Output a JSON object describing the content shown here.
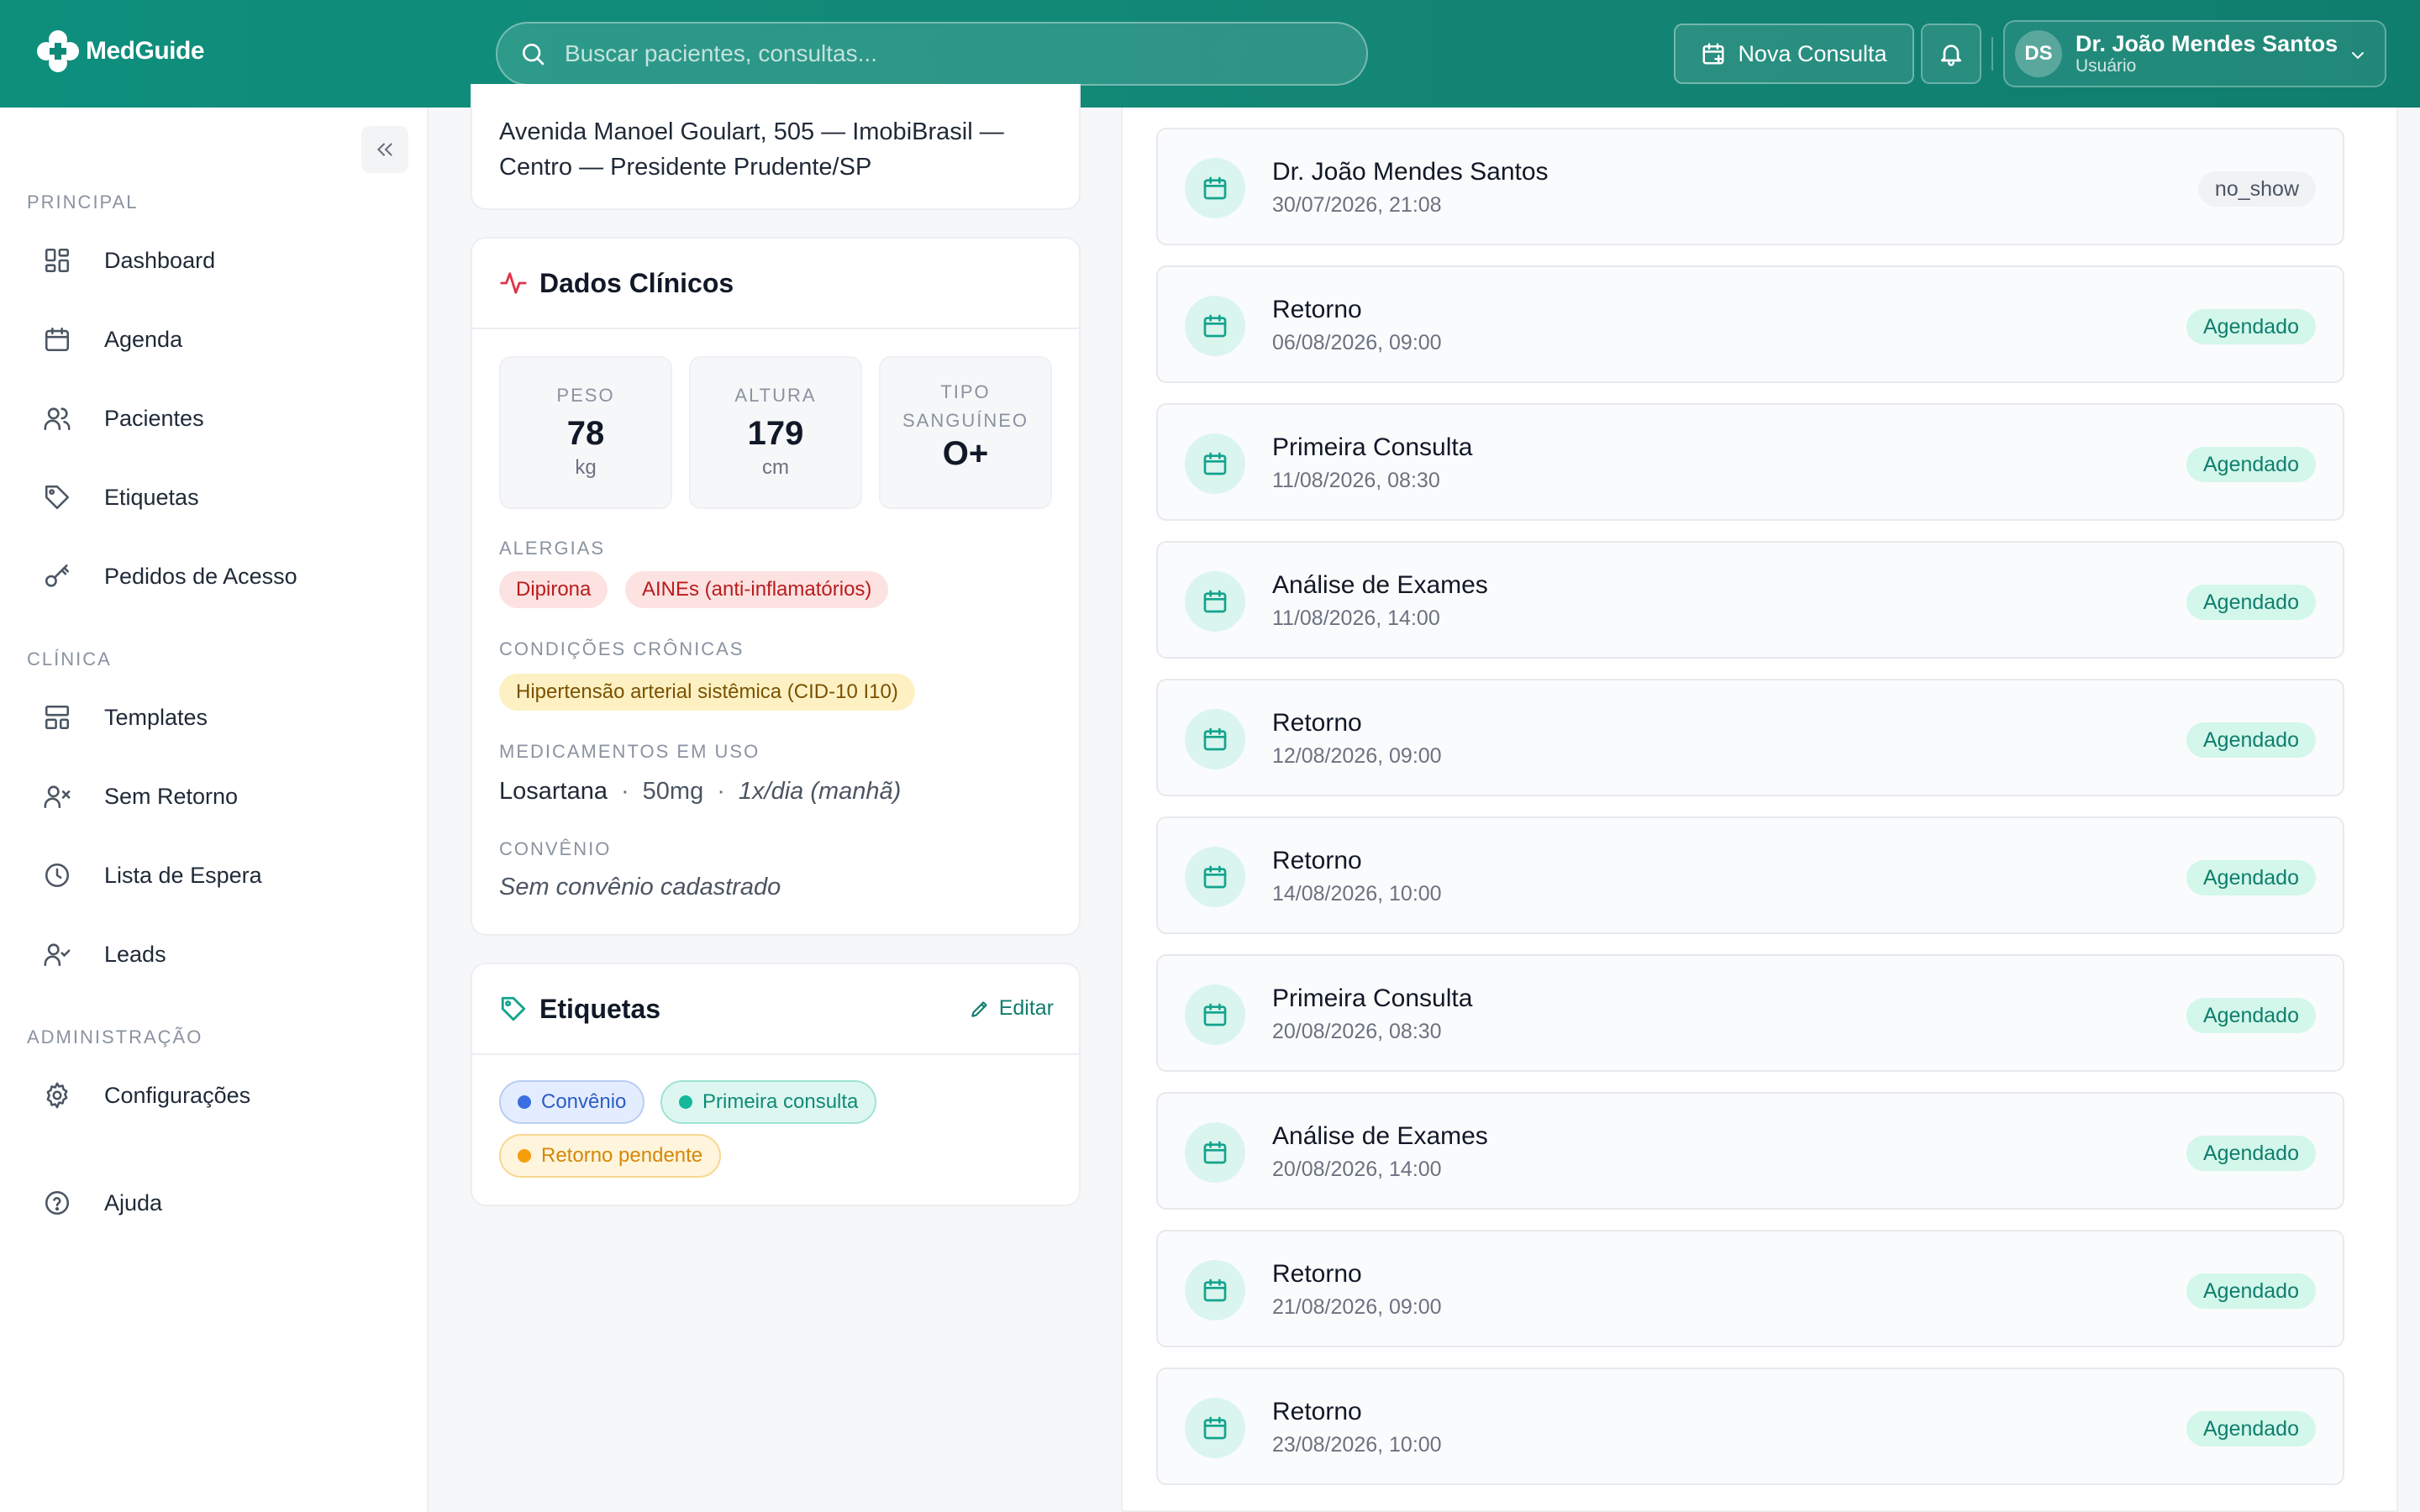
{
  "brand": {
    "name": "MedGuide",
    "colors": {
      "primary": "#0f7e6e",
      "accent": "#d3f7ea"
    }
  },
  "search": {
    "placeholder": "Buscar pacientes, consultas..."
  },
  "header": {
    "new_consult_label": "Nova Consulta",
    "user": {
      "initials": "DS",
      "name": "Dr. João Mendes Santos",
      "role": "Usuário"
    }
  },
  "sidebar": {
    "sections": [
      {
        "label": "PRINCIPAL",
        "items": [
          {
            "label": "Dashboard",
            "icon": "dashboard-icon"
          },
          {
            "label": "Agenda",
            "icon": "calendar-icon"
          },
          {
            "label": "Pacientes",
            "icon": "users-icon"
          },
          {
            "label": "Etiquetas",
            "icon": "tag-icon"
          },
          {
            "label": "Pedidos de Acesso",
            "icon": "key-icon"
          }
        ]
      },
      {
        "label": "CLÍNICA",
        "items": [
          {
            "label": "Templates",
            "icon": "layout-icon"
          },
          {
            "label": "Sem Retorno",
            "icon": "user-x-icon"
          },
          {
            "label": "Lista de Espera",
            "icon": "clock-icon"
          },
          {
            "label": "Leads",
            "icon": "user-check-icon"
          }
        ]
      },
      {
        "label": "ADMINISTRAÇÃO",
        "items": [
          {
            "label": "Configurações",
            "icon": "gear-icon"
          }
        ]
      }
    ],
    "help_label": "Ajuda"
  },
  "patient": {
    "address": "Avenida Manoel Goulart, 505 — ImobiBrasil — Centro — Presidente Prudente/SP"
  },
  "clinical": {
    "title": "Dados Clínicos",
    "metrics": [
      {
        "label": "PESO",
        "value": "78",
        "unit": "kg"
      },
      {
        "label": "ALTURA",
        "value": "179",
        "unit": "cm"
      },
      {
        "label": "TIPO SANGUÍNEO",
        "value": "O+",
        "unit": ""
      }
    ],
    "allergies_label": "ALERGIAS",
    "allergies": [
      "Dipirona",
      "AINEs (anti-inflamatórios)"
    ],
    "chronic_label": "CONDIÇÕES CRÔNICAS",
    "chronic": [
      "Hipertensão arterial sistêmica (CID-10 I10)"
    ],
    "medications_label": "MEDICAMENTOS EM USO",
    "medication": {
      "name": "Losartana",
      "dose": "50mg",
      "frequency": "1x/dia (manhã)",
      "separator": "·"
    },
    "insurance_label": "CONVÊNIO",
    "insurance_value": "Sem convênio cadastrado"
  },
  "tags": {
    "title": "Etiquetas",
    "edit_label": "Editar",
    "items": [
      {
        "label": "Convênio",
        "color": "#3b6fe0"
      },
      {
        "label": "Primeira consulta",
        "color": "#14b89a"
      },
      {
        "label": "Retorno pendente",
        "color": "#f59e0b"
      }
    ]
  },
  "appointments": [
    {
      "title": "Dr. João Mendes Santos",
      "date": "30/07/2026, 21:08",
      "status": "no_show"
    },
    {
      "title": "Retorno",
      "date": "06/08/2026, 09:00",
      "status": "Agendado"
    },
    {
      "title": "Primeira Consulta",
      "date": "11/08/2026, 08:30",
      "status": "Agendado"
    },
    {
      "title": "Análise de Exames",
      "date": "11/08/2026, 14:00",
      "status": "Agendado"
    },
    {
      "title": "Retorno",
      "date": "12/08/2026, 09:00",
      "status": "Agendado"
    },
    {
      "title": "Retorno",
      "date": "14/08/2026, 10:00",
      "status": "Agendado"
    },
    {
      "title": "Primeira Consulta",
      "date": "20/08/2026, 08:30",
      "status": "Agendado"
    },
    {
      "title": "Análise de Exames",
      "date": "20/08/2026, 14:00",
      "status": "Agendado"
    },
    {
      "title": "Retorno",
      "date": "21/08/2026, 09:00",
      "status": "Agendado"
    },
    {
      "title": "Retorno",
      "date": "23/08/2026, 10:00",
      "status": "Agendado"
    }
  ]
}
